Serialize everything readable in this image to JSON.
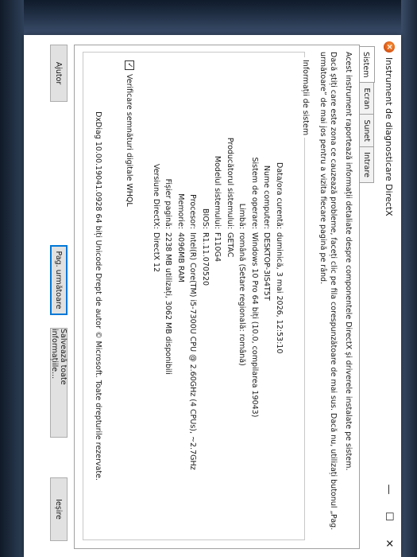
{
  "window": {
    "title": "Instrument de diagnosticare DirectX",
    "icon": "directx-icon",
    "minimize": "—",
    "maximize": "☐",
    "close": "✕"
  },
  "tabs": [
    {
      "label": "Sistem",
      "active": true
    },
    {
      "label": "Ecran",
      "active": false
    },
    {
      "label": "Sunet",
      "active": false
    },
    {
      "label": "Intrare",
      "active": false
    }
  ],
  "intro": {
    "line1": "Acest instrument raportează informații detaliate despre componentele DirectX și driverele instalate pe sistem.",
    "line2": "Dacă știți care este zona ce cauzează probleme, faceți clic pe fila corespunzătoare de mai sus. Dacă nu, utilizați butonul „Pag. următoare” de mai jos pentru a vizita fiecare pagină pe rând."
  },
  "system_info": {
    "group_title": "Informații de sistem",
    "rows": [
      {
        "label": "Data/ora curentă:",
        "value": "duminică, 3 mai 2026, 12:53:10"
      },
      {
        "label": "Nume computer:",
        "value": "DESKTOP-3IS4T5T"
      },
      {
        "label": "Sistem de operare:",
        "value": "Windows 10 Pro 64 biți (10.0, compilarea 19043)"
      },
      {
        "label": "Limbă:",
        "value": "română (Setare regională: română)"
      },
      {
        "label": "Producătorul sistemului:",
        "value": "GETAC"
      },
      {
        "label": "Modelul sistemului:",
        "value": "F110G4"
      },
      {
        "label": "BIOS:",
        "value": "R1.11.070520"
      },
      {
        "label": "Procesor:",
        "value": "Intel(R) Core(TM) i5-7300U CPU @ 2.60GHz (4 CPUs), ~2.7GHz"
      },
      {
        "label": "Memorie:",
        "value": "4096MB RAM"
      },
      {
        "label": "Fișier pagină:",
        "value": "2238 MB utilizați, 3062 MB disponibili"
      },
      {
        "label": "Versiune DirectX:",
        "value": "DirectX 12"
      }
    ],
    "whql_label": "Verificare semnături digitale WHQL",
    "whql_checked": true,
    "whql_mark": "✓",
    "copyright": "DxDiag 10.00.19041.0928 64 biți Unicode  Drept de autor © Microsoft. Toate drepturile rezervate."
  },
  "buttons": {
    "help": "Ajutor",
    "next_page": "Pag. următoare",
    "save_all": "Salvează toate informațiile...",
    "exit": "Ieșire"
  }
}
